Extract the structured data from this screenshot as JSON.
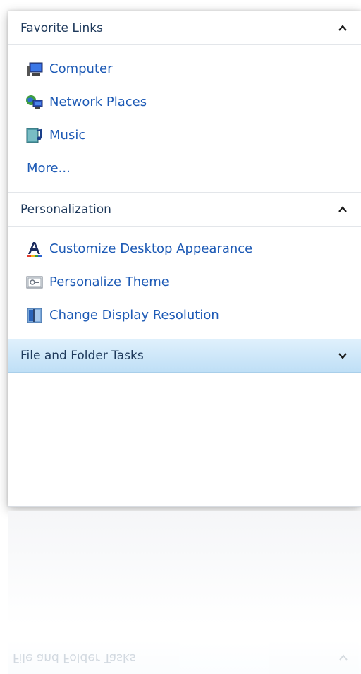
{
  "favorite_links": {
    "title": "Favorite Links",
    "items": [
      {
        "label": "Computer",
        "icon": "computer-icon"
      },
      {
        "label": "Network Places",
        "icon": "network-places-icon"
      },
      {
        "label": "Music",
        "icon": "music-icon"
      }
    ],
    "more_label": "More..."
  },
  "personalization": {
    "title": "Personalization",
    "items": [
      {
        "label": "Customize Desktop Appearance",
        "icon": "font-appearance-icon"
      },
      {
        "label": "Personalize Theme",
        "icon": "theme-icon"
      },
      {
        "label": "Change Display Resolution",
        "icon": "display-resolution-icon"
      }
    ]
  },
  "file_folder_tasks": {
    "title": "File and Folder Tasks",
    "reflection_text": "File and Folder Tasks"
  },
  "colors": {
    "link": "#1d5ab5",
    "header_text": "#1e395b",
    "active_header": "#c9e5f8"
  }
}
